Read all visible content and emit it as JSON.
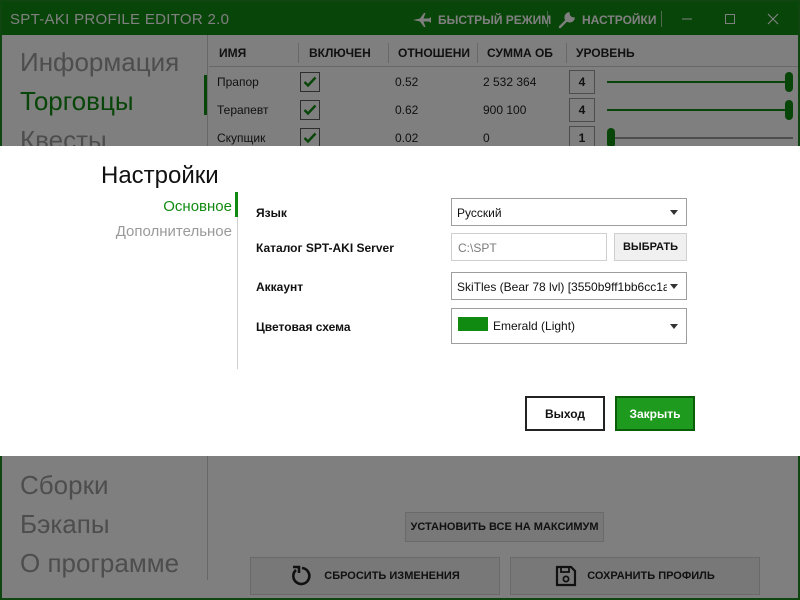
{
  "window": {
    "title": "SPT-AKI PROFILE EDITOR  2.0",
    "fast_mode_label": "БЫСТРЫЙ РЕЖИМ",
    "settings_label": "НАСТРОЙКИ"
  },
  "sidebar": {
    "items": [
      {
        "label": "Информация",
        "active": false
      },
      {
        "label": "Торговцы",
        "active": true
      },
      {
        "label": "Квесты",
        "active": false
      },
      {
        "label": "Сборки",
        "active": false
      },
      {
        "label": "Бэкапы",
        "active": false
      },
      {
        "label": "О программе",
        "active": false
      }
    ]
  },
  "traders": {
    "columns": [
      "ИМЯ",
      "ВКЛЮЧЕН",
      "ОТНОШЕНИ",
      "СУММА ОБ",
      "УРОВЕНЬ"
    ],
    "rows": [
      {
        "name": "Прапор",
        "enabled": true,
        "relation": "0.52",
        "sum": "2 532 364",
        "level": "4",
        "level_fraction": 1.0
      },
      {
        "name": "Терапевт",
        "enabled": true,
        "relation": "0.62",
        "sum": "900 100",
        "level": "4",
        "level_fraction": 1.0
      },
      {
        "name": "Скупщик",
        "enabled": true,
        "relation": "0.02",
        "sum": "0",
        "level": "1",
        "level_fraction": 0.0
      }
    ]
  },
  "actions": {
    "set_all_max": "УСТАНОВИТЬ ВСЕ НА МАКСИМУМ",
    "reset_changes": "СБРОСИТЬ ИЗМЕНЕНИЯ",
    "save_profile": "СОХРАНИТЬ ПРОФИЛЬ"
  },
  "dialog": {
    "title": "Настройки",
    "nav": [
      {
        "label": "Основное",
        "active": true
      },
      {
        "label": "Дополнительное",
        "active": false
      }
    ],
    "language_label": "Язык",
    "language_value": "Русский",
    "server_dir_label": "Каталог SPT-AKI Server",
    "server_dir_value": "C:\\SPT",
    "browse_label": "ВЫБРАТЬ",
    "account_label": "Аккаунт",
    "account_value": "SkiTles (Bear 78 lvl) [3550b9ff1bb6cc1a",
    "scheme_label": "Цветовая схема",
    "scheme_value": "Emerald (Light)",
    "scheme_color": "#118a11",
    "exit_label": "Выход",
    "close_label": "Закрыть"
  },
  "colors": {
    "accent": "#118a11",
    "overlay": "rgba(0,0,0,0.5)"
  }
}
